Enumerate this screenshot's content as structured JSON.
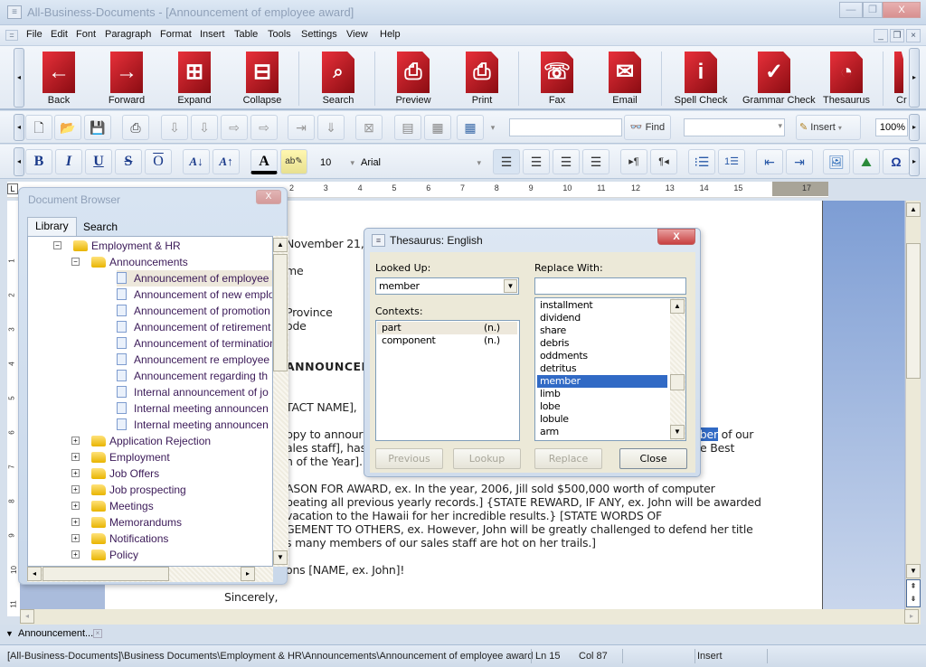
{
  "window": {
    "title": "All-Business-Documents - [Announcement of employee award]",
    "controls": {
      "minimize": "—",
      "restore": "❐",
      "close": "X"
    }
  },
  "menu": [
    "File",
    "Edit",
    "Font",
    "Paragraph",
    "Format",
    "Insert",
    "Table",
    "Tools",
    "Settings",
    "View",
    "Help"
  ],
  "big_toolbar": [
    {
      "label": "Back",
      "icon": "back-arrow-icon",
      "glyph": "←"
    },
    {
      "label": "Forward",
      "icon": "forward-arrow-icon",
      "glyph": "→"
    },
    {
      "label": "Expand",
      "icon": "expand-tree-icon",
      "glyph": "⊞"
    },
    {
      "label": "Collapse",
      "icon": "collapse-tree-icon",
      "glyph": "⊟"
    },
    {
      "label": "Search",
      "icon": "search-icon",
      "glyph": "🔍"
    },
    {
      "label": "Preview",
      "icon": "print-preview-icon",
      "glyph": "⎙"
    },
    {
      "label": "Print",
      "icon": "print-icon",
      "glyph": "⎙"
    },
    {
      "label": "Fax",
      "icon": "fax-icon",
      "glyph": "☏"
    },
    {
      "label": "Email",
      "icon": "email-icon",
      "glyph": "✉"
    },
    {
      "label": "Spell Check",
      "icon": "spell-check-icon",
      "glyph": "i"
    },
    {
      "label": "Grammar Check",
      "icon": "grammar-check-icon",
      "glyph": "✓"
    },
    {
      "label": "Thesaurus",
      "icon": "thesaurus-icon",
      "glyph": "◔"
    },
    {
      "label": "Cr",
      "icon": "create-icon",
      "glyph": ""
    }
  ],
  "toolbar2": {
    "find_label": "Find",
    "insert_label": "Insert",
    "zoom_value": "100%",
    "find_input": "",
    "style_select": ""
  },
  "format_toolbar": {
    "bold": "B",
    "italic": "I",
    "underline": "U",
    "strike": "S",
    "overline": "O",
    "font_size": "10",
    "font_name": "Arial"
  },
  "ruler": {
    "ticks": [
      "2",
      "3",
      "4",
      "5",
      "6",
      "7",
      "8",
      "9",
      "10",
      "11",
      "12",
      "13",
      "14",
      "15",
      "17"
    ],
    "vticks": [
      "1",
      "2",
      "3",
      "4",
      "5",
      "6",
      "7",
      "8",
      "9",
      "10",
      "11"
    ]
  },
  "document": {
    "lines": [
      "November 21,",
      "me",
      "Province",
      "ode",
      "ANNOUNCEM",
      "TACT NAME],",
      "ppy to annour",
      "ales staff], has",
      "n of the Year].",
      "ASON FOR AWARD, ex. In the year, 2006, Jill sold $500,000 worth of computer",
      "beating all previous yearly records.]  {STATE REWARD, IF ANY, ex. John will be awarded",
      "vacation to the Hawaii for her incredible results.}  [STATE WORDS OF",
      "GEMENT TO OTHERS, ex. However, John will be greatly challenged to defend her title",
      "s many members of our sales staff are hot on her trails.]",
      "ons [NAME, ex. John]!",
      "Sincerely,"
    ],
    "selected_fragment": "nber",
    "after_selected": " of our",
    "line_best": "e Best"
  },
  "doc_browser": {
    "title": "Document Browser",
    "tabs": [
      "Library",
      "Search"
    ],
    "active_tab": "Library",
    "tree": [
      {
        "label": "Employment & HR",
        "type": "folder",
        "expanded": true,
        "level": 0
      },
      {
        "label": "Announcements",
        "type": "folder",
        "expanded": true,
        "level": 1
      },
      {
        "label": "Announcement of employee award",
        "type": "doc",
        "level": 2,
        "selected": true
      },
      {
        "label": "Announcement of new employee",
        "type": "doc",
        "level": 2
      },
      {
        "label": "Announcement of promotion",
        "type": "doc",
        "level": 2
      },
      {
        "label": "Announcement of retirement",
        "type": "doc",
        "level": 2
      },
      {
        "label": "Announcement of termination",
        "type": "doc",
        "level": 2
      },
      {
        "label": "Announcement re employee",
        "type": "doc",
        "level": 2
      },
      {
        "label": "Announcement regarding th",
        "type": "doc",
        "level": 2
      },
      {
        "label": "Internal announcement of jo",
        "type": "doc",
        "level": 2
      },
      {
        "label": "Internal meeting announcen",
        "type": "doc",
        "level": 2
      },
      {
        "label": "Internal meeting announcen",
        "type": "doc",
        "level": 2
      },
      {
        "label": "Application Rejection",
        "type": "folder",
        "expanded": false,
        "level": 1
      },
      {
        "label": "Employment",
        "type": "folder",
        "expanded": false,
        "level": 1
      },
      {
        "label": "Job Offers",
        "type": "folder",
        "expanded": false,
        "level": 1
      },
      {
        "label": "Job prospecting",
        "type": "folder",
        "expanded": false,
        "level": 1
      },
      {
        "label": "Meetings",
        "type": "folder",
        "expanded": false,
        "level": 1
      },
      {
        "label": "Memorandums",
        "type": "folder",
        "expanded": false,
        "level": 1
      },
      {
        "label": "Notifications",
        "type": "folder",
        "expanded": false,
        "level": 1
      },
      {
        "label": "Policy",
        "type": "folder",
        "expanded": false,
        "level": 1
      }
    ]
  },
  "thesaurus": {
    "title": "Thesaurus: English",
    "looked_up_label": "Looked Up:",
    "looked_up_value": "member",
    "replace_with_label": "Replace With:",
    "replace_with_value": "",
    "contexts_label": "Contexts:",
    "contexts": [
      {
        "word": "part",
        "pos": "(n.)",
        "selected": true
      },
      {
        "word": "component",
        "pos": "(n.)"
      }
    ],
    "synonyms": [
      "installment",
      "dividend",
      "share",
      "debris",
      "oddments",
      "detritus",
      "member",
      "limb",
      "lobe",
      "lobule",
      "arm"
    ],
    "selected_synonym": "member",
    "buttons": {
      "previous": "Previous",
      "lookup": "Lookup",
      "replace": "Replace",
      "close": "Close"
    }
  },
  "doc_tab": {
    "label": "Announcement..."
  },
  "status": {
    "path": "[All-Business-Documents]\\Business Documents\\Employment & HR\\Announcements\\Announcement of employee award",
    "line": "Ln 15",
    "col": "Col 87",
    "mode": "Insert"
  },
  "colors": {
    "accent_red": "#c0141c",
    "selection": "#316ac5",
    "tree_text": "#3b1a58"
  }
}
